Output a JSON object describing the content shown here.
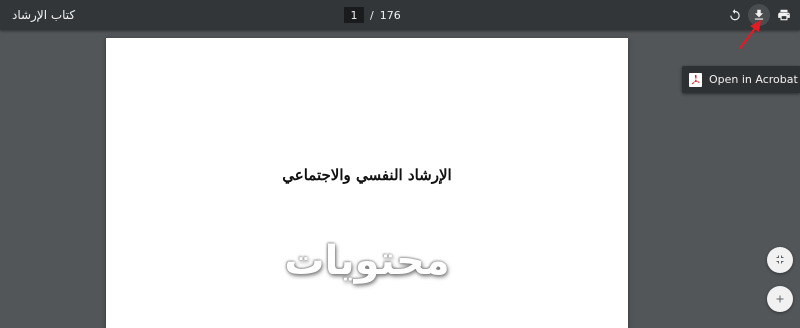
{
  "toolbar": {
    "title": "كتاب الإرشاد",
    "current_page": "1",
    "separator": "/",
    "total_pages": "176",
    "icons": {
      "rotate": "rotate-icon",
      "download": "download-icon",
      "print": "print-icon"
    }
  },
  "document": {
    "title": "الإرشاد النفسي والاجتماعي",
    "watermark": "محتويات"
  },
  "acrobat_popup": {
    "label": "Open in Acrobat",
    "icon": "acrobat-icon"
  },
  "zoom_controls": {
    "fit_icon": "fit-to-page-icon",
    "zoom_in_icon": "zoom-in-icon"
  },
  "annotation": {
    "arrow_color": "#e31b23"
  },
  "colors": {
    "toolbar_bg": "#323639",
    "viewer_bg": "#525659",
    "page_bg": "#ffffff",
    "popup_bg": "#2e3133"
  }
}
